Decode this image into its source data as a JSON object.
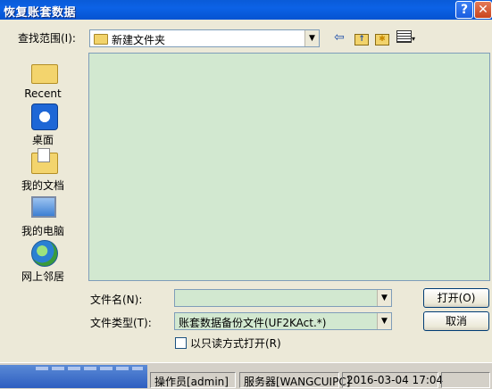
{
  "window": {
    "title": "恢复账套数据",
    "help_label": "?",
    "close_label": "✕"
  },
  "lookin": {
    "label": "查找范围(I):",
    "value": "新建文件夹"
  },
  "toolbar": {
    "back_icon": "back-arrow-icon",
    "up_icon": "up-folder-icon",
    "new_icon": "new-folder-icon",
    "view_icon": "view-menu-icon"
  },
  "places": [
    {
      "label": "Recent"
    },
    {
      "label": "桌面"
    },
    {
      "label": "我的文档"
    },
    {
      "label": "我的电脑"
    },
    {
      "label": "网上邻居"
    }
  ],
  "filename": {
    "label": "文件名(N):",
    "value": ""
  },
  "filetype": {
    "label": "文件类型(T):",
    "value": "账套数据备份文件(UF2KAct.*)"
  },
  "buttons": {
    "open": "打开(O)",
    "cancel": "取消"
  },
  "readonly": {
    "label": "以只读方式打开(R)",
    "checked": false
  },
  "statusbar": {
    "operator": "操作员[admin]",
    "server": "服务器[WANGCUIPC]",
    "datetime": "2016-03-04 17:04"
  },
  "colors": {
    "titlebar": "#0c62e6",
    "list_background": "#d2e8d0"
  }
}
